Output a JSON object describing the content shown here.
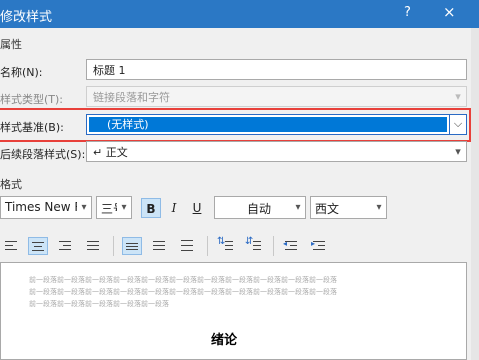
{
  "window": {
    "title": "修改样式",
    "help": "?",
    "close": "×"
  },
  "sections": {
    "properties": "属性",
    "format": "格式"
  },
  "properties": {
    "name_label": "名称(N):",
    "name_value": "标题 1",
    "type_label": "样式类型(T):",
    "type_value": "链接段落和字符",
    "based_on_label": "样式基准(B):",
    "based_on_value": "(无样式)",
    "following_label": "后续段落样式(S):",
    "following_value": "↵ 正文"
  },
  "format": {
    "font": "Times New Ro",
    "size": "三号",
    "bold": "B",
    "italic": "I",
    "underline": "U",
    "color": "自动",
    "script": "西文"
  },
  "preview": {
    "sample_line_1": "前一段落前一段落前一段落前一段落前一段落前一段落前一段落前一段落前一段落前一段落前一段落",
    "sample_line_2": "前一段落前一段落前一段落前一段落前一段落前一段落前一段落前一段落前一段落前一段落前一段落",
    "sample_line_3": "前一段落前一段落前一段落前一段落前一段落",
    "heading": "绪论"
  }
}
